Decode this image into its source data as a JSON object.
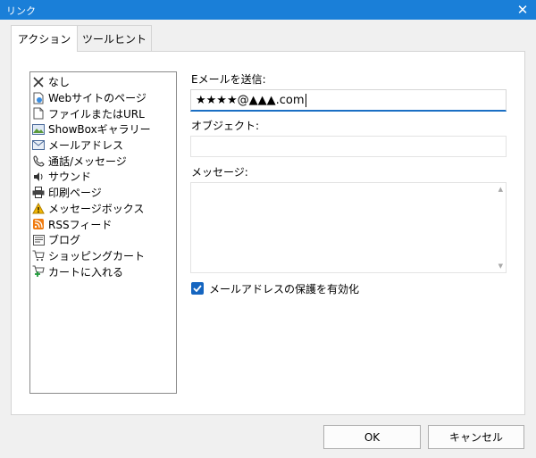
{
  "window": {
    "title": "リンク",
    "close_glyph": "✕"
  },
  "tabs": [
    {
      "label": "アクション",
      "active": true
    },
    {
      "label": "ツールヒント",
      "active": false
    }
  ],
  "actions": [
    {
      "label": "なし",
      "icon": "x-icon"
    },
    {
      "label": "Webサイトのページ",
      "icon": "web-page-icon"
    },
    {
      "label": "ファイルまたはURL",
      "icon": "file-icon"
    },
    {
      "label": "ShowBoxギャラリー",
      "icon": "gallery-icon"
    },
    {
      "label": "メールアドレス",
      "icon": "envelope-icon"
    },
    {
      "label": "通話/メッセージ",
      "icon": "phone-icon"
    },
    {
      "label": "サウンド",
      "icon": "speaker-icon"
    },
    {
      "label": "印刷ページ",
      "icon": "printer-icon"
    },
    {
      "label": "メッセージボックス",
      "icon": "warning-icon"
    },
    {
      "label": "RSSフィード",
      "icon": "rss-icon"
    },
    {
      "label": "ブログ",
      "icon": "blog-icon"
    },
    {
      "label": "ショッピングカート",
      "icon": "cart-icon"
    },
    {
      "label": "カートに入れる",
      "icon": "add-to-cart-icon"
    }
  ],
  "form": {
    "email_label": "Eメールを送信:",
    "email_value": "★★★★@▲▲▲.com",
    "subject_label": "オブジェクト:",
    "subject_value": "",
    "message_label": "メッセージ:",
    "message_value": "",
    "protect_label": "メールアドレスの保護を有効化",
    "protect_checked": true
  },
  "buttons": {
    "ok": "OK",
    "cancel": "キャンセル"
  },
  "colors": {
    "titlebar": "#1a7fd8",
    "accent": "#1565c0"
  }
}
